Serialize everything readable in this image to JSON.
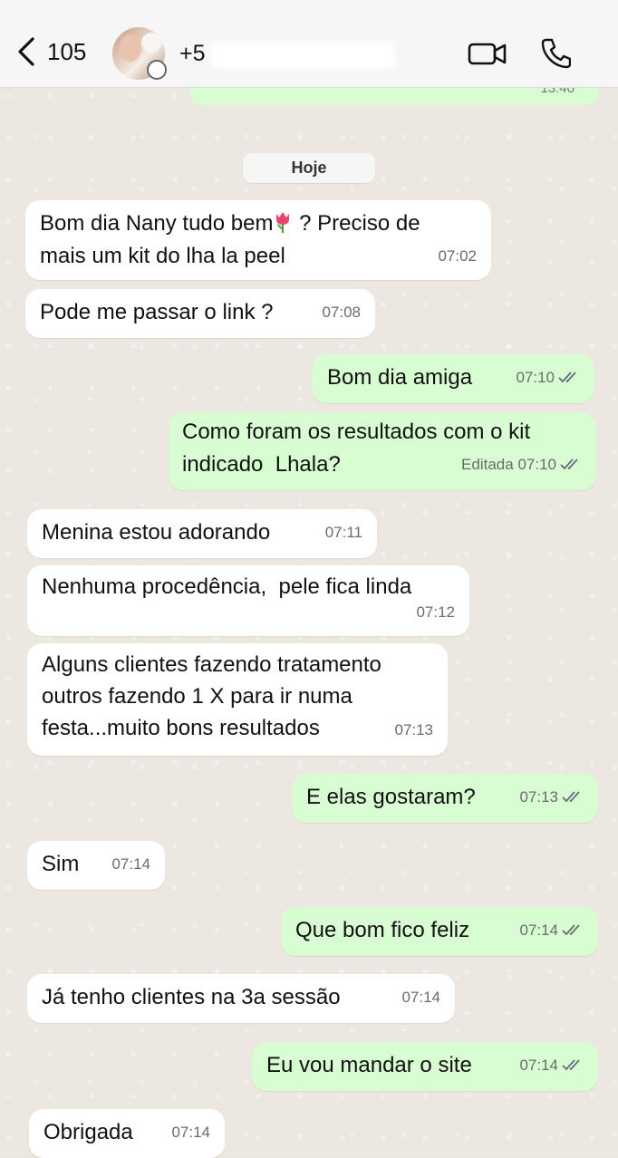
{
  "header": {
    "back_count": "105",
    "contact_name_visible": "+5",
    "colors": {
      "header_bg": "#f6f6f6",
      "outgoing": "#d9fdd3",
      "incoming": "#ffffff"
    }
  },
  "previous": {
    "time": "13:40"
  },
  "date_separator": "Hoje",
  "messages": [
    {
      "dir": "in",
      "line1": "Bom dia Nany tudo bem",
      "line1b": " ? Preciso de",
      "line2": "mais um kit do lha la peel",
      "time": "07:02",
      "emoji": "tulip-icon"
    },
    {
      "dir": "in",
      "text": "Pode me passar o link ?",
      "time": "07:08"
    },
    {
      "dir": "out",
      "text": "Bom dia amiga",
      "time": "07:10"
    },
    {
      "dir": "out",
      "text": "Como foram os resultados com o kit\nindicado  Lhala?",
      "time": "07:10",
      "edited": "Editada"
    },
    {
      "dir": "in",
      "text": "Menina estou adorando",
      "time": "07:11"
    },
    {
      "dir": "in",
      "text": "Nenhuma procedência,  pele fica linda",
      "time": "07:12"
    },
    {
      "dir": "in",
      "text": "Alguns clientes fazendo tratamento\noutros fazendo 1 X para ir numa\nfesta...muito bons resultados",
      "time": "07:13"
    },
    {
      "dir": "out",
      "text": "E elas gostaram?",
      "time": "07:13"
    },
    {
      "dir": "in",
      "text": "Sim",
      "time": "07:14"
    },
    {
      "dir": "out",
      "text": "Que bom fico feliz",
      "time": "07:14"
    },
    {
      "dir": "in",
      "text": "Já tenho clientes na 3a sessão",
      "time": "07:14"
    },
    {
      "dir": "out",
      "text": "Eu vou mandar o site",
      "time": "07:14"
    },
    {
      "dir": "in",
      "text": "Obrigada",
      "time": "07:14"
    }
  ]
}
